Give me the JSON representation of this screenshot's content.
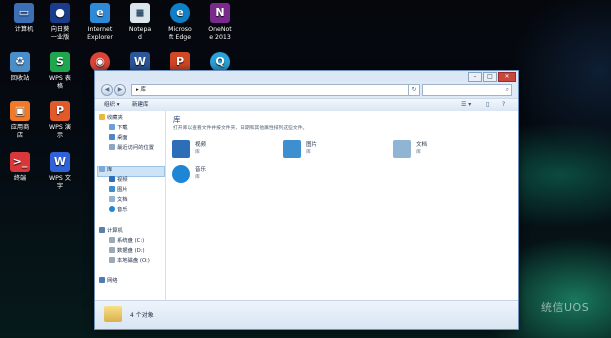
{
  "desktop": {
    "icons": [
      {
        "label": "计算机",
        "icon": "computer-icon",
        "color": "#3b6fb6"
      },
      {
        "label": "向日葵\n一业版",
        "icon": "sunflower-icon",
        "color": "#1b3c8a"
      },
      {
        "label": "Internet\nExplorer",
        "icon": "ie-icon",
        "color": "#2d8ad8"
      },
      {
        "label": "Notepa\nd",
        "icon": "notepad-icon",
        "color": "#d9e6ee"
      },
      {
        "label": "Microso\nft Edge",
        "icon": "edge-icon",
        "color": "#0f7fc7"
      },
      {
        "label": "OneNot\ne 2013",
        "icon": "onenote-icon",
        "color": "#7a2a8d"
      },
      {
        "label": "回收站",
        "icon": "recycle-bin-icon",
        "color": "#4a8ec9"
      },
      {
        "label": "WPS 表\n格",
        "icon": "wps-sheet-icon",
        "color": "#1fa64e"
      },
      {
        "label": "",
        "icon": "chrome-icon",
        "color": "#db4437"
      },
      {
        "label": "",
        "icon": "word-icon",
        "color": "#2b579a"
      },
      {
        "label": "",
        "icon": "powerpoint-icon",
        "color": "#d24726"
      },
      {
        "label": "",
        "icon": "search-app-icon",
        "color": "#2aa1d8"
      },
      {
        "label": "应用商\n店",
        "icon": "app-store-icon",
        "color": "#f07a2a"
      },
      {
        "label": "WPS 演\n示",
        "icon": "wps-present-icon",
        "color": "#e05a2b"
      },
      {
        "label": "终端",
        "icon": "terminal-icon",
        "color": "#d9383a"
      },
      {
        "label": "WPS 文\n字",
        "icon": "wps-writer-icon",
        "color": "#2f62d8"
      }
    ]
  },
  "explorer": {
    "address": "库",
    "nav_back_glyph": "◀",
    "nav_fwd_glyph": "▶",
    "refresh_glyph": "↻",
    "search_glyph": "⌕",
    "search_placeholder": "",
    "window_buttons": {
      "minimize": "–",
      "maximize": "□",
      "close": "✕"
    },
    "toolbar": {
      "organize": "组织 ▾",
      "new_library": "新建库",
      "view_glyph": "☰ ▾",
      "pane_glyph": "▯",
      "help_glyph": "?"
    },
    "sidebar": {
      "favorites": "收藏夹",
      "favorite_items": [
        "下载",
        "桌面",
        "最近访问的位置"
      ],
      "libraries": "库",
      "library_items": [
        "视频",
        "图片",
        "文档",
        "音乐"
      ],
      "computer": "计算机",
      "computer_items": [
        "系统盘 (C:)",
        "数据盘 (D:)",
        "本地磁盘 (O:)"
      ],
      "network": "网络"
    },
    "main": {
      "title": "库",
      "description": "打开库以查看文件并按文件夹、日期和其他属性排列这些文件。",
      "items": [
        {
          "name": "视频",
          "type": "库",
          "color": "#2c6fb8"
        },
        {
          "name": "图片",
          "type": "库",
          "color": "#3d8fcf"
        },
        {
          "name": "文档",
          "type": "库",
          "color": "#8fb4d4"
        },
        {
          "name": "音乐",
          "type": "库",
          "color": "#1f86d6"
        }
      ]
    },
    "status": {
      "text": "4 个对象"
    }
  },
  "watermark": {
    "text": "统信UOS"
  }
}
